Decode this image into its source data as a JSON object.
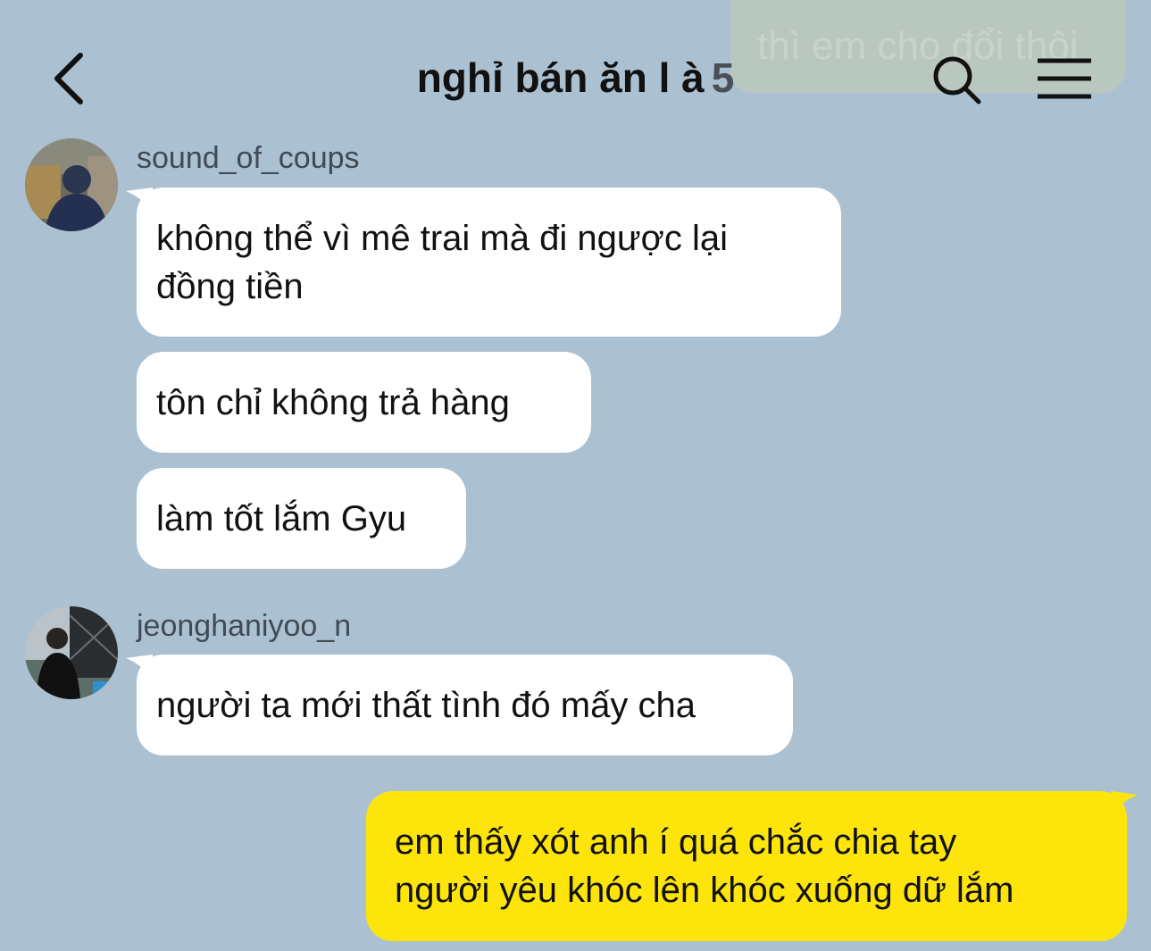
{
  "header": {
    "title": "nghỉ bán ăn l à",
    "member_count": "5"
  },
  "ghost_message": "thì em cho đổi thôi",
  "messages": [
    {
      "sender": "sound_of_coups",
      "lines": [
        "không thể vì mê trai mà đi ngược lại",
        "đồng tiền"
      ]
    },
    {
      "text": "tôn chỉ không trả hàng"
    },
    {
      "text": "làm tốt lắm Gyu"
    },
    {
      "sender": "jeonghaniyoo_n",
      "text": "người ta mới thất tình đó mấy cha"
    },
    {
      "mine": true,
      "lines": [
        "em thấy xót anh í quá chắc chia tay",
        "người yêu khóc lên khóc xuống dữ lắm"
      ]
    }
  ],
  "colors": {
    "background": "#abc1d1",
    "incoming_bubble": "#ffffff",
    "outgoing_bubble": "#fde50b"
  }
}
